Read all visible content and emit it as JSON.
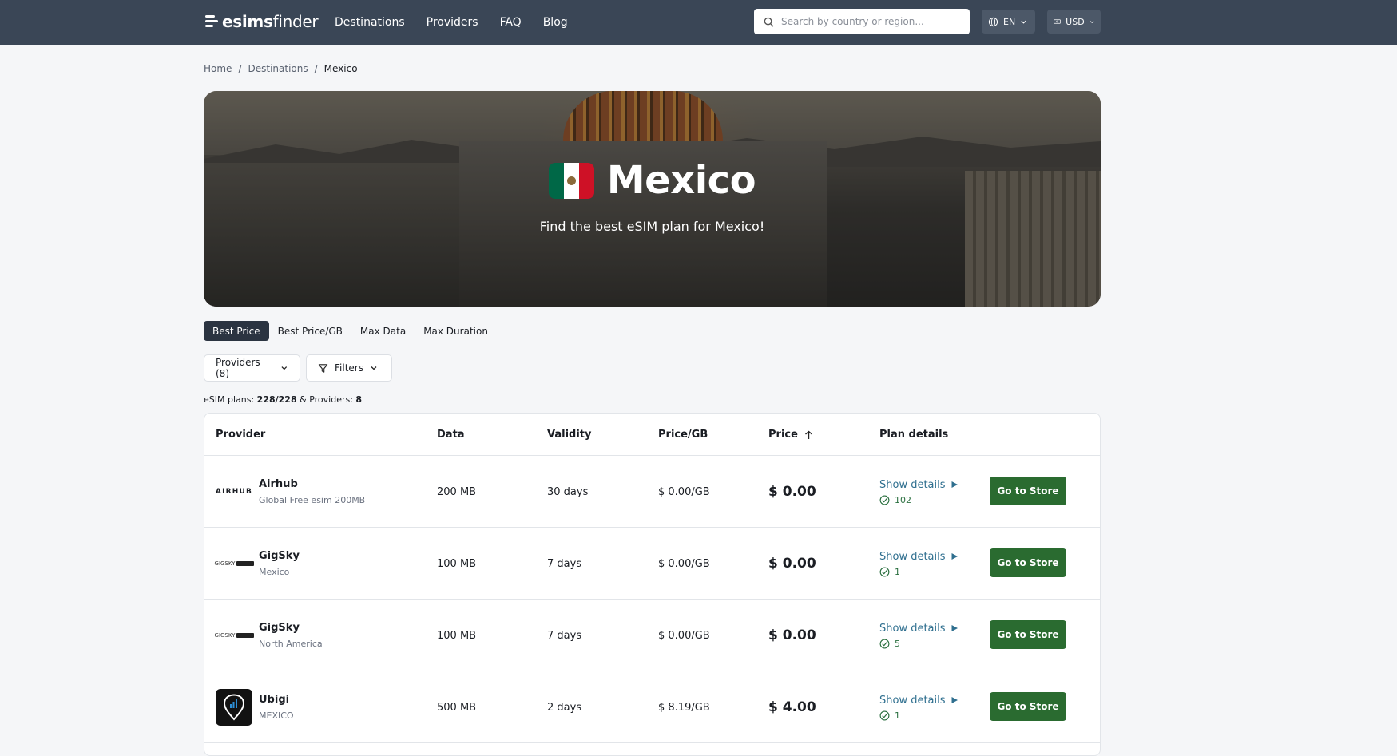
{
  "nav": {
    "logo_bold": "esims",
    "logo_light": "finder",
    "links": [
      "Destinations",
      "Providers",
      "FAQ",
      "Blog"
    ],
    "search_placeholder": "Search by country or region...",
    "lang": "EN",
    "currency": "USD"
  },
  "breadcrumb": [
    "Home",
    "Destinations",
    "Mexico"
  ],
  "hero": {
    "title": "Mexico",
    "subtitle": "Find the best eSIM plan for Mexico!",
    "flag_colors": [
      "#006847",
      "#ffffff",
      "#ce1126"
    ]
  },
  "tabs": [
    "Best Price",
    "Best Price/GB",
    "Max Data",
    "Max Duration"
  ],
  "filters": {
    "providers_label": "Providers (8)",
    "filters_label": "Filters"
  },
  "summary": {
    "prefix": "eSIM plans: ",
    "plans": "228/228",
    "mid": " & Providers: ",
    "providers": "8"
  },
  "table": {
    "headers": [
      "Provider",
      "Data",
      "Validity",
      "Price/GB",
      "Price",
      "Plan details"
    ],
    "show_details": "Show details",
    "store_label": "Go to Store",
    "rows": [
      {
        "provider": "Airhub",
        "plan": "Global Free esim 200MB",
        "logo": "airhub",
        "logo_text": "AIRHUB",
        "data": "200 MB",
        "validity": "30 days",
        "price_gb": "$ 0.00/GB",
        "price": "$ 0.00",
        "countries": "102"
      },
      {
        "provider": "GigSky",
        "plan": "Mexico",
        "logo": "gigsky",
        "logo_text": "GIGSKY",
        "data": "100 MB",
        "validity": "7 days",
        "price_gb": "$ 0.00/GB",
        "price": "$ 0.00",
        "countries": "1"
      },
      {
        "provider": "GigSky",
        "plan": "North America",
        "logo": "gigsky",
        "logo_text": "GIGSKY",
        "data": "100 MB",
        "validity": "7 days",
        "price_gb": "$ 0.00/GB",
        "price": "$ 0.00",
        "countries": "5"
      },
      {
        "provider": "Ubigi",
        "plan": "MEXICO",
        "logo": "ubigi",
        "logo_text": "",
        "data": "500 MB",
        "validity": "2 days",
        "price_gb": "$ 8.19/GB",
        "price": "$ 4.00",
        "countries": "1"
      }
    ]
  },
  "colors": {
    "nav_bg": "#3a4656",
    "store_button": "#2a6b30",
    "link": "#2f6f8f",
    "active_tab": "#2b3441"
  }
}
